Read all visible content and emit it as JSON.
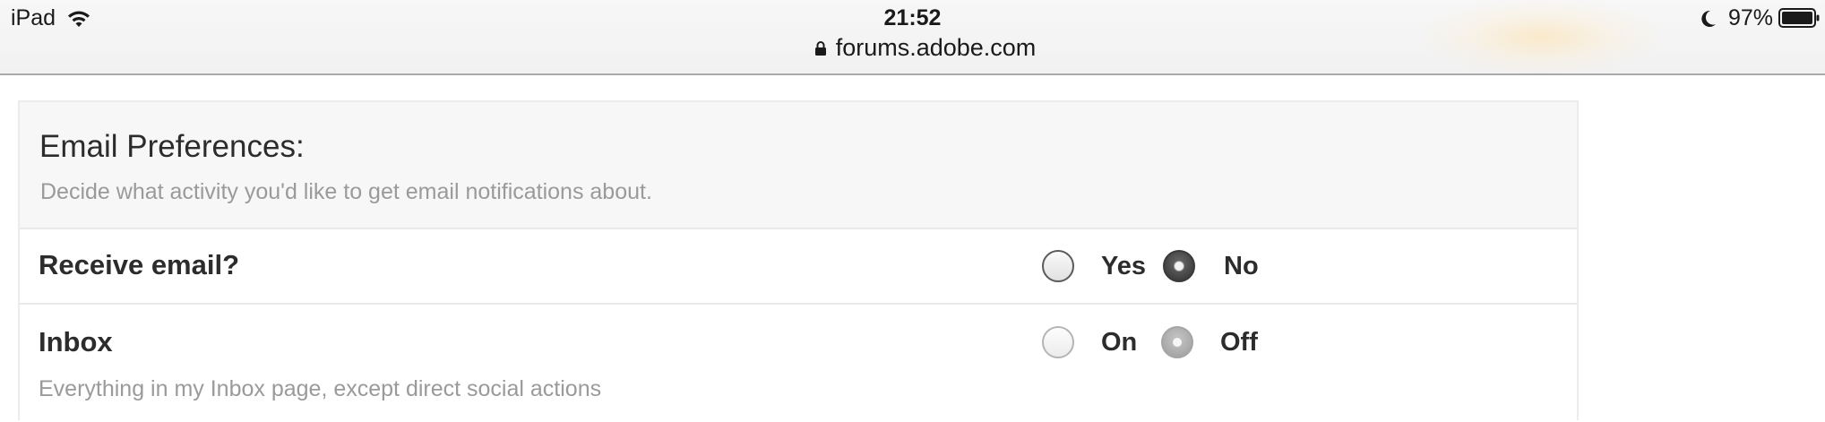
{
  "status_bar": {
    "device": "iPad",
    "time": "21:52",
    "url": "forums.adobe.com",
    "battery_percent": "97%",
    "icons": [
      "wifi-icon",
      "lock-icon",
      "moon-icon",
      "battery-icon"
    ]
  },
  "email_preferences": {
    "title": "Email Preferences:",
    "description": "Decide what activity you'd like to get email notifications about.",
    "receive_email": {
      "label": "Receive email?",
      "options": [
        {
          "label": "Yes",
          "selected": false
        },
        {
          "label": "No",
          "selected": true
        }
      ]
    },
    "inbox": {
      "label": "Inbox",
      "description": "Everything in my Inbox page, except direct social actions",
      "enabled": false,
      "options": [
        {
          "label": "On",
          "selected": false
        },
        {
          "label": "Off",
          "selected": true
        }
      ]
    }
  }
}
